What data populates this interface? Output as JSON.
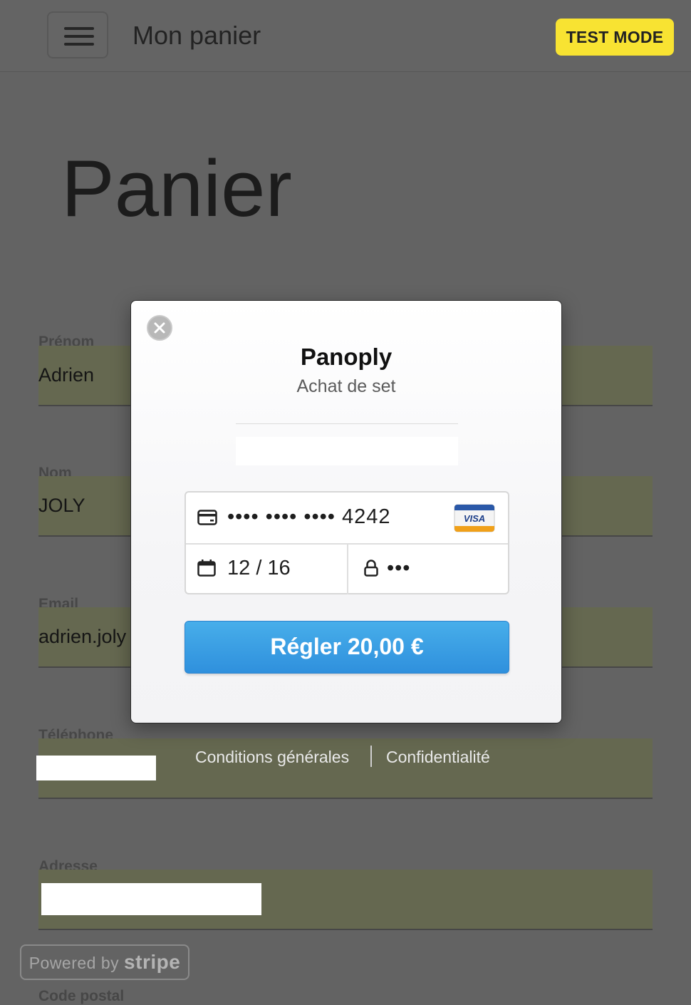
{
  "header": {
    "title": "Mon panier",
    "test_mode": "TEST MODE"
  },
  "page": {
    "heading": "Panier"
  },
  "form": {
    "fields": [
      {
        "label": "Prénom",
        "value": "Adrien"
      },
      {
        "label": "Nom",
        "value": "JOLY"
      },
      {
        "label": "Email",
        "value": "adrien.joly"
      },
      {
        "label": "Téléphone",
        "value": ""
      },
      {
        "label": "Adresse",
        "value": ""
      },
      {
        "label": "Code postal",
        "value": ""
      }
    ]
  },
  "footer": {
    "terms": "Conditions générales",
    "privacy": "Confidentialité",
    "powered_by": "Powered by",
    "stripe": "stripe"
  },
  "checkout": {
    "merchant": "Panoply",
    "description": "Achat de set",
    "card_number": "•••• •••• •••• 4242",
    "card_brand": "VISA",
    "expiry": "12 / 16",
    "cvc": "•••",
    "pay_label": "Régler 20,00 €"
  },
  "colors": {
    "accent": "#3a9de4",
    "badge": "#f8e332",
    "overlay": "#636363"
  }
}
